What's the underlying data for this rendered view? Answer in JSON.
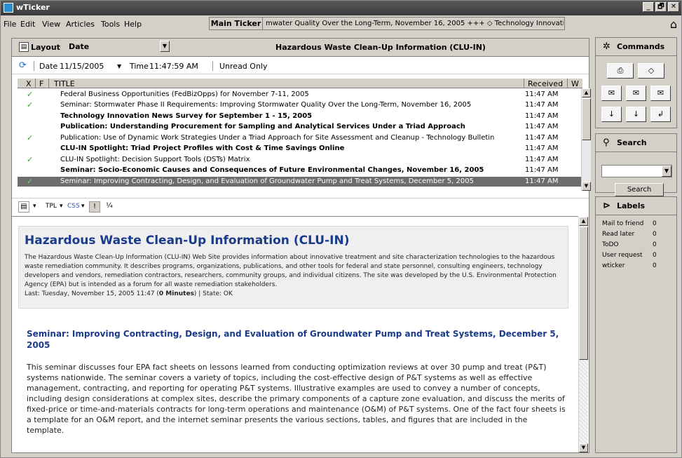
{
  "app": {
    "title": "wTicker"
  },
  "window_buttons": [
    "_",
    "🗗",
    "✕"
  ],
  "menu": [
    "File",
    "Edit",
    "View",
    "Articles",
    "Tools",
    "Help"
  ],
  "ticker": {
    "label": "Main Ticker",
    "text": "mwater Quality Over the Long-Term, November 16, 2005   +++   ◇ Technology Innovation"
  },
  "panel": {
    "layout_label": "Layout",
    "layout_value": "Date",
    "title": "Hazardous Waste Clean-Up Information (CLU-IN)"
  },
  "filter": {
    "date_label": "Date",
    "date_value": "11/15/2005",
    "time_label": "Time",
    "time_value": "11:47:59 AM",
    "unread_only": "Unread Only"
  },
  "list": {
    "columns": [
      "X",
      "F",
      "TITLE",
      "Received",
      "W"
    ],
    "rows": [
      {
        "read": true,
        "bold": false,
        "selected": false,
        "title": "Federal Business Opportunities (FedBizOpps) for November 7-11, 2005",
        "received": "11:47 AM"
      },
      {
        "read": true,
        "bold": false,
        "selected": false,
        "title": "Seminar: Stormwater Phase II Requirements: Improving Stormwater Quality Over the Long-Term, November 16, 2005",
        "received": "11:47 AM"
      },
      {
        "read": false,
        "bold": true,
        "selected": false,
        "title": "Technology Innovation News Survey for September 1 - 15, 2005",
        "received": "11:47 AM"
      },
      {
        "read": false,
        "bold": true,
        "selected": false,
        "title": "Publication: Understanding Procurement for Sampling and Analytical Services Under a Triad Approach",
        "received": "11:47 AM"
      },
      {
        "read": true,
        "bold": false,
        "selected": false,
        "title": "Publication: Use of Dynamic Work Strategies Under a Triad Approach for Site Assessment and Cleanup - Technology Bulletin",
        "received": "11:47 AM"
      },
      {
        "read": false,
        "bold": true,
        "selected": false,
        "title": "CLU-IN Spotlight: Triad Project Profiles with Cost & Time Savings Online",
        "received": "11:47 AM"
      },
      {
        "read": true,
        "bold": false,
        "selected": false,
        "title": "CLU-IN Spotlight: Decision Support Tools (DSTs) Matrix",
        "received": "11:47 AM"
      },
      {
        "read": false,
        "bold": true,
        "selected": false,
        "title": "Seminar: Socio-Economic Causes and Consequences of Future Environmental Changes, November 16, 2005",
        "received": "11:47 AM"
      },
      {
        "read": true,
        "bold": false,
        "selected": true,
        "title": "Seminar: Improving Contracting, Design, and Evaluation of Groundwater Pump and Treat Systems, December 5, 2005",
        "received": "11:47 AM"
      }
    ]
  },
  "toolstrip": {
    "tpl": "TPL",
    "css": "CSS"
  },
  "content": {
    "heading": "Hazardous Waste Clean-Up Information (CLU-IN)",
    "description": "The Hazardous Waste Clean-Up Information (CLU-IN) Web Site provides information about innovative treatment and site characterization technologies to the hazardous waste remediation community. It describes programs, organizations, publications, and other tools for federal and state personnel, consulting engineers, technology developers and vendors, remediation contractors, researchers, community groups, and individual citizens. The site was developed by the U.S. Environmental Protection Agency (EPA) but is intended as a forum for all waste remediation stakeholders.",
    "last_prefix": "Last: Tuesday, November 15, 2005 11:47 (",
    "last_minutes": "0 Minutes",
    "last_suffix": ")  |  State: OK",
    "article_title": "Seminar: Improving Contracting, Design, and Evaluation of Groundwater Pump and Treat Systems, December 5, 2005",
    "article_body": "This seminar discusses four EPA fact sheets on lessons learned from conducting optimization reviews at over 30 pump and treat (P&T) systems nationwide. The seminar covers a variety of topics, including the cost-effective design of P&T systems as well as effective management, contracting, and reporting for operating P&T systems. Illustrative examples are used to convey a number of concepts, including design considerations at complex sites, describe the primary components of a capture zone evaluation, and discuss the merits of fixed-price or time-and-materials contracts for long-term operations and maintenance (O&M) of P&T systems. One of the fact four sheets is a template for an O&M report, and the internet seminar presents the various sections, tables, and figures that are included in the template."
  },
  "commands": {
    "title": "Commands"
  },
  "search": {
    "title": "Search",
    "button": "Search"
  },
  "labels": {
    "title": "Labels",
    "items": [
      {
        "name": "Mail to friend",
        "count": "0"
      },
      {
        "name": "Read later",
        "count": "0"
      },
      {
        "name": "ToDO",
        "count": "0"
      },
      {
        "name": "User request",
        "count": "0"
      },
      {
        "name": "wticker",
        "count": "0"
      }
    ]
  }
}
